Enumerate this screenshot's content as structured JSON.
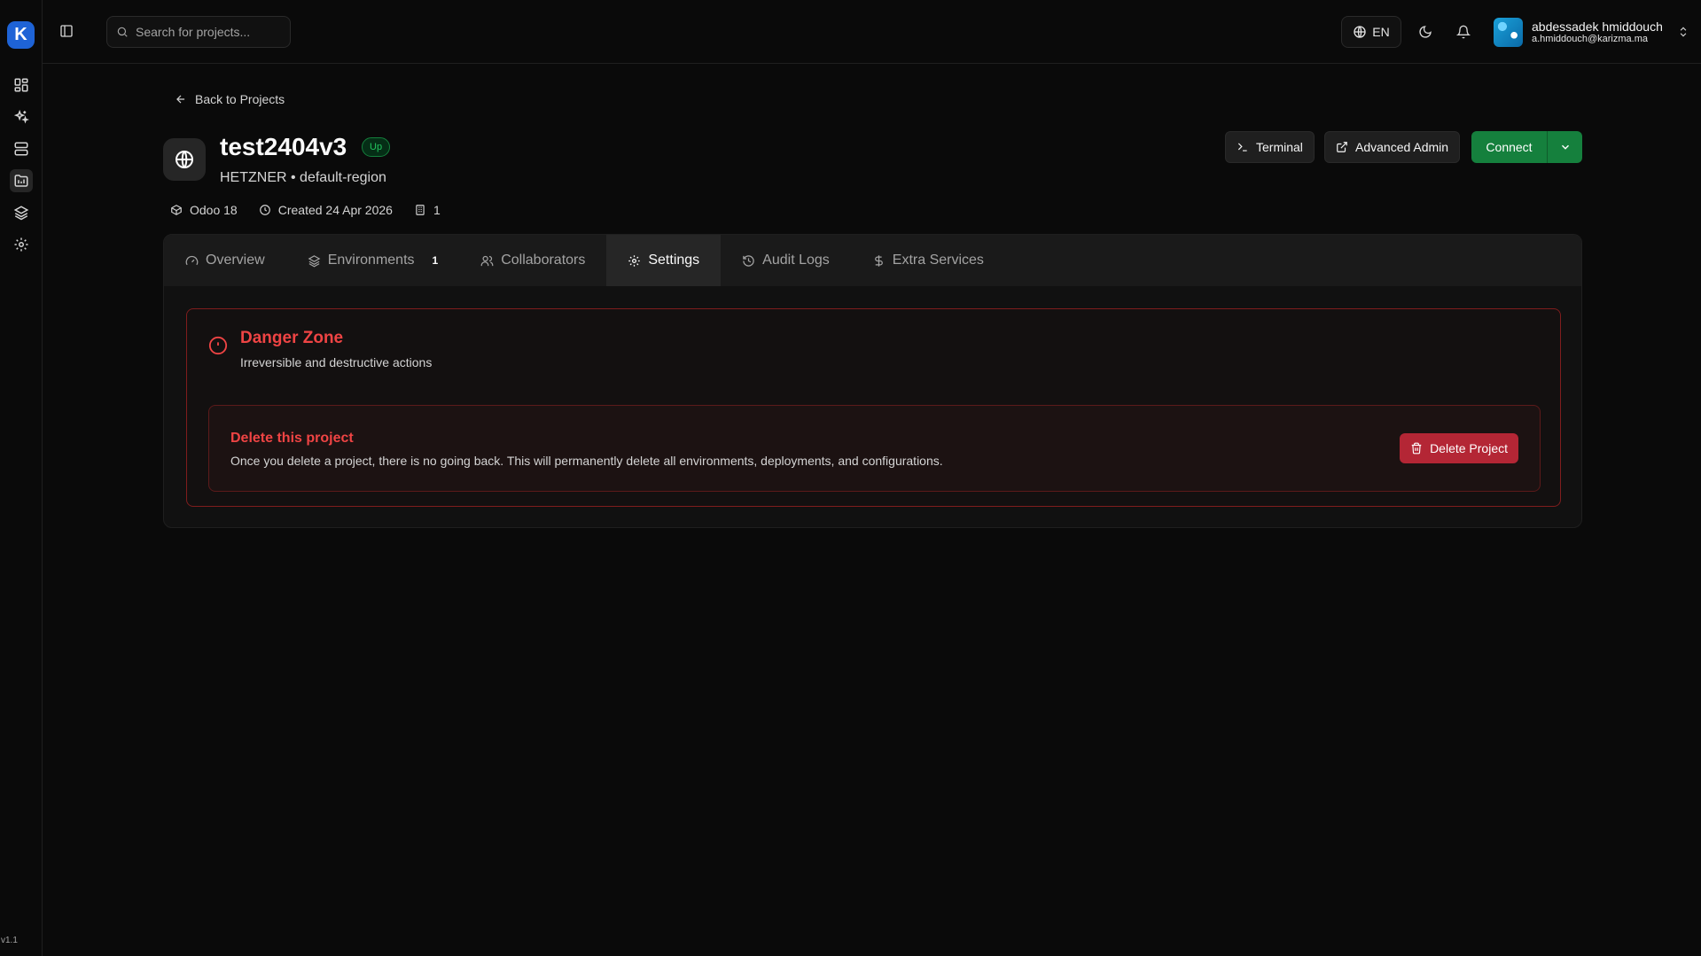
{
  "sidebar": {
    "logo_text": "K",
    "icons": [
      "dashboard-icon",
      "sparkles-icon",
      "servers-icon",
      "projects-icon",
      "layers-icon",
      "settings-icon"
    ],
    "version": "v1.1"
  },
  "header": {
    "search_placeholder": "Search for projects...",
    "language": "EN",
    "user_name": "abdessadek hmiddouch",
    "user_email": "a.hmiddouch@karizma.ma"
  },
  "project": {
    "back_label": "Back to Projects",
    "name": "test2404v3",
    "status": "Up",
    "provider_region": "HETZNER • default-region",
    "version_label": "Odoo 18",
    "created_label": "Created 24 Apr 2026",
    "env_count": "1"
  },
  "actions": {
    "terminal": "Terminal",
    "advanced_admin": "Advanced Admin",
    "connect": "Connect"
  },
  "tabs": [
    {
      "label": "Overview"
    },
    {
      "label": "Environments",
      "count": "1"
    },
    {
      "label": "Collaborators"
    },
    {
      "label": "Settings"
    },
    {
      "label": "Audit Logs"
    },
    {
      "label": "Extra Services"
    }
  ],
  "active_tab": "Settings",
  "danger_zone": {
    "title": "Danger Zone",
    "description": "Irreversible and destructive actions",
    "delete_title": "Delete this project",
    "delete_description": "Once you delete a project, there is no going back. This will permanently delete all environments, deployments, and configurations.",
    "delete_button": "Delete Project"
  },
  "colors": {
    "accent_green": "#15803d",
    "danger_red": "#ef4444",
    "logo_blue": "#1e63d6"
  }
}
